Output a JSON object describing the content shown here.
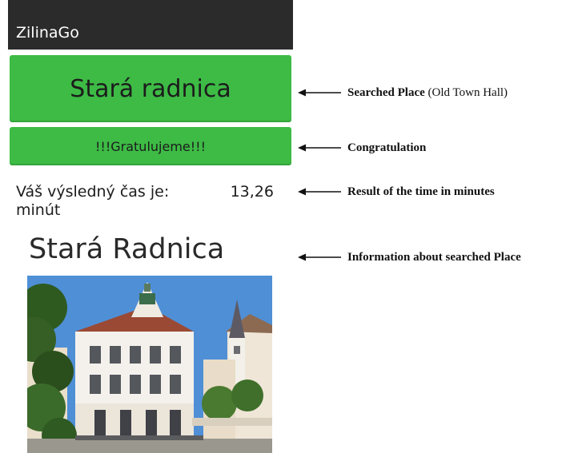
{
  "app": {
    "title": "ZilinaGo"
  },
  "screen": {
    "place_button": "Stará radnica",
    "congrats_button": "!!!Gratulujeme!!!",
    "result_label": "Váš výsledný čas je:",
    "result_value": "13,26",
    "result_unit": "minút",
    "info_title": "Stará Radnica"
  },
  "annotations": {
    "searched_place_bold": "Searched Place",
    "searched_place_rest": "(Old Town Hall)",
    "congratulation": "Congratulation",
    "result": "Result of the time in minutes",
    "information": "Information about searched Place"
  },
  "colors": {
    "button_green": "#3dbb45",
    "actionbar": "#2b2b2b"
  },
  "icons": [
    "arrow-left-icon"
  ]
}
